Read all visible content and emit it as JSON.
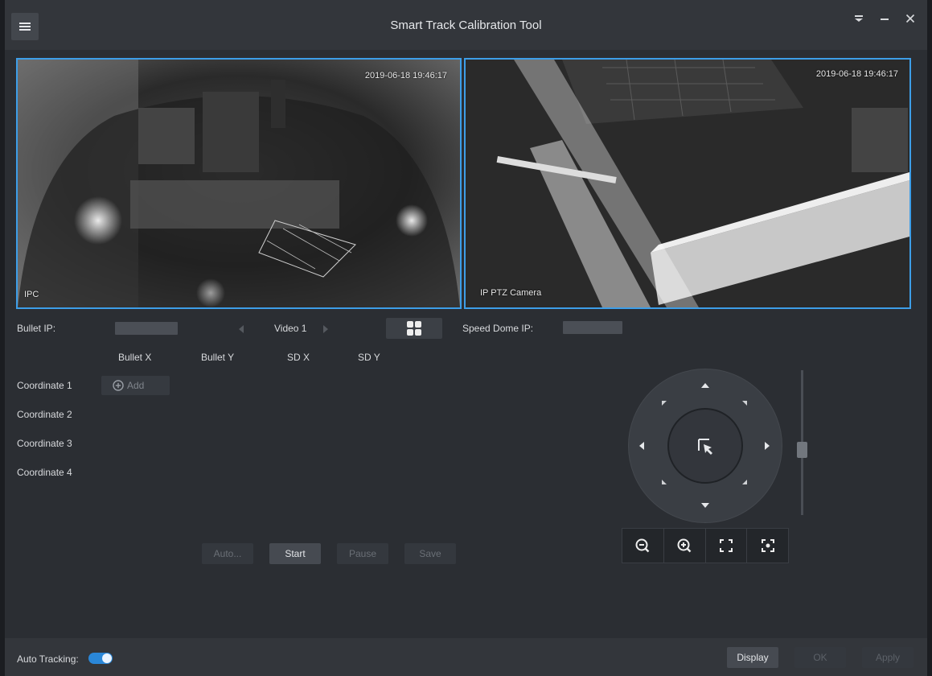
{
  "window": {
    "title": "Smart Track Calibration Tool",
    "menu_icon": "hamburger-icon",
    "controls": [
      "dropdown-icon",
      "minimize-icon",
      "close-icon"
    ]
  },
  "video_left": {
    "timestamp": "2019-06-18 19:46:17",
    "label": "IPC"
  },
  "video_right": {
    "timestamp": "2019-06-18 19:46:17",
    "label": "IP PTZ Camera"
  },
  "info": {
    "bullet_ip_label": "Bullet IP:",
    "video_label": "Video 1",
    "speed_dome_ip_label": "Speed Dome IP:"
  },
  "table": {
    "columns": [
      "Bullet X",
      "Bullet Y",
      "SD X",
      "SD Y"
    ],
    "rows": [
      "Coordinate 1",
      "Coordinate 2",
      "Coordinate 3",
      "Coordinate 4"
    ],
    "add_label": "Add"
  },
  "actions": {
    "auto": "Auto...",
    "start": "Start",
    "pause": "Pause",
    "save": "Save"
  },
  "footer": {
    "auto_tracking_label": "Auto Tracking:",
    "auto_tracking_on": true,
    "display": "Display",
    "ok": "OK",
    "apply": "Apply"
  },
  "colors": {
    "accent": "#3d9ee8",
    "toggle": "#2a87d8",
    "background": "#2b2e33"
  }
}
